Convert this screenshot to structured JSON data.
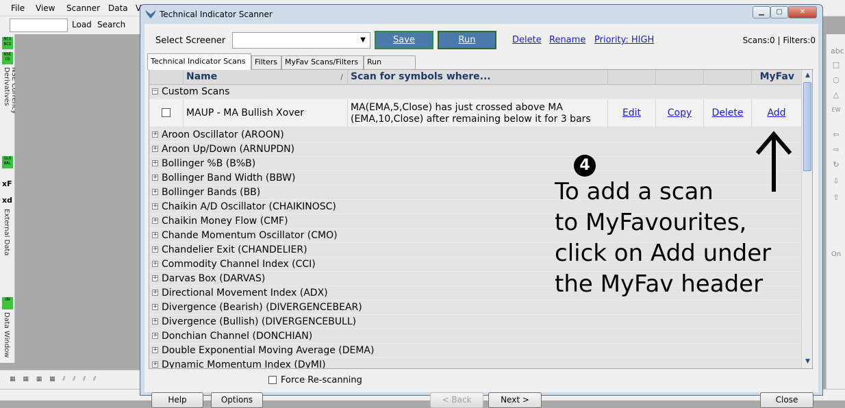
{
  "app": {
    "menu": [
      "File",
      "View",
      "Scanner",
      "Data",
      "V"
    ],
    "toolbar": {
      "load": "Load",
      "search": "Search"
    },
    "left_strip": {
      "badge1": "MCX NCX",
      "badge2": "NSE CD",
      "label1": "NSE Currency Derivatives",
      "badge3": "GLO BAL",
      "xf": "xF",
      "xd": "xd",
      "label2": "External Data",
      "badge4": "dW",
      "label3": "Data Window"
    },
    "right_strip": [
      "abc",
      "□",
      "○",
      "△",
      "EW",
      "⇦",
      "⇨",
      "↻",
      "⇩",
      "⇧",
      "On"
    ]
  },
  "dialog": {
    "title": "Technical Indicator Scanner",
    "select_label": "Select Screener",
    "screener_value": "",
    "save_label": "Save",
    "run_label": "Run",
    "delete_label": "Delete",
    "rename_label": "Rename",
    "priority_label": "Priority: HIGH",
    "scans_count": "Scans:0 | Filters:0",
    "tabs": [
      "Technical Indicator Scans",
      "Filters",
      "MyFav Scans/Filters",
      "Run Options"
    ],
    "grid": {
      "header_name": "Name",
      "header_sep": "/",
      "header_scan": "Scan for symbols where...",
      "header_myfav": "MyFav",
      "custom_group": "Custom Scans",
      "custom_row": {
        "name": "MAUP - MA Bullish Xover",
        "condition_line1": "MA(EMA,5,Close) has just crossed above MA",
        "condition_line2": "(EMA,10,Close) after remaining below it for 3 bars",
        "edit": "Edit",
        "copy": "Copy",
        "delete": "Delete",
        "add": "Add"
      },
      "groups": [
        "Aroon Oscillator (AROON)",
        "Aroon Up/Down (ARNUPDN)",
        "Bollinger %B (B%B)",
        "Bollinger Band Width (BBW)",
        "Bollinger Bands (BB)",
        "Chaikin A/D Oscillator (CHAIKINOSC)",
        "Chaikin Money Flow (CMF)",
        "Chande Momentum Oscillator (CMO)",
        "Chandelier Exit (CHANDELIER)",
        "Commodity Channel Index (CCI)",
        "Darvas Box (DARVAS)",
        "Directional Movement Index (ADX)",
        "Divergence (Bearish) (DIVERGENCEBEAR)",
        "Divergence (Bullish) (DIVERGENCEBULL)",
        "Donchian Channel (DONCHIAN)",
        "Double Exponential Moving Average (DEMA)",
        "Dynamic Momentum Index (DyMI)"
      ]
    },
    "annotation": {
      "step": "4",
      "line1": "To add a scan",
      "line2": "to MyFavourites,",
      "line3": "click on Add under",
      "line4": "the MyFav header"
    },
    "footer": {
      "help": "Help",
      "options": "Options",
      "force_rescan": "Force Re-scanning",
      "back": "< Back",
      "next": "Next >",
      "close": "Close"
    }
  }
}
